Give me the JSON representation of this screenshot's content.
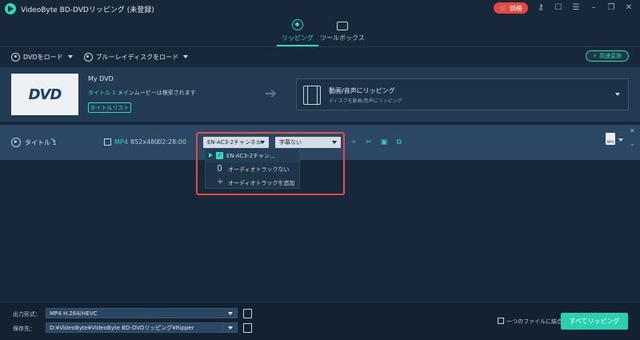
{
  "app": {
    "title": "VideoByte BD-DVDリッピング (未登録)",
    "price_label": "価格"
  },
  "tabs": [
    {
      "label": "リッピング",
      "active": true
    },
    {
      "label": "ツールボックス",
      "active": false
    }
  ],
  "toolbar": {
    "load_dvd": "DVDをロード",
    "load_bluray": "ブルーレイディスクをロード",
    "fast_convert": "高速変換"
  },
  "disc": {
    "thumb_logo": "DVD",
    "name": "My DVD",
    "main_title_prefix": "タイトル 1",
    "main_title_suffix": " メインムービーは検索されます",
    "title_list_button": "タイトルリスト",
    "output_title": "動画/音声にリッピング",
    "output_subtitle": "ディスクを動画/音声にリッピング"
  },
  "title_row": {
    "label": "タイトル 1",
    "format": "MP4",
    "resolution": "852x480",
    "duration": "02:28:00",
    "audio_selected": "EN-AC3-2チャンネル",
    "subtitle_selected": "字幕ない",
    "output_format_badge": "MP4"
  },
  "audio_dropdown": {
    "items": [
      {
        "label": "EN-AC3-2チャン...",
        "checked": true
      },
      {
        "label": "オーディオトラックない"
      },
      {
        "label": "オーディオトラックを追加"
      }
    ]
  },
  "bottom": {
    "output_format_label": "出力形式：",
    "output_format_value": "MP4 H.264/HEVC",
    "save_to_label": "保存先：",
    "save_to_value": "D:¥VideoByte¥VideoByte BD-DVDリッピング¥Ripper",
    "merge_label": "一つのファイルに結合",
    "rip_all_button": "すべてリッピング"
  },
  "colors": {
    "accent": "#2ad1b0",
    "highlight_box": "#e84a4a",
    "price_badge": "#e8473b",
    "background": "#16283a"
  }
}
